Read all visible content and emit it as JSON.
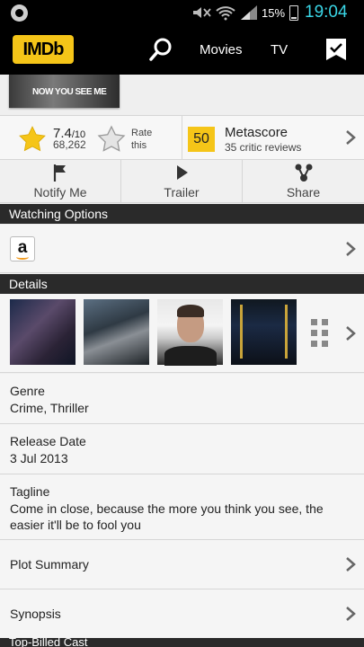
{
  "status_bar": {
    "battery": "15%",
    "time": "19:04"
  },
  "app_bar": {
    "logo": "IMDb",
    "nav_movies": "Movies",
    "nav_tv": "TV"
  },
  "poster": {
    "title_text": "NOW YOU SEE ME"
  },
  "rating": {
    "value": "7.4",
    "out_of": "/10",
    "count": "68,262",
    "rate_label": "Rate this"
  },
  "metascore": {
    "score": "50",
    "title": "Metascore",
    "reviews": "35 critic reviews"
  },
  "actions": {
    "notify": "Notify Me",
    "trailer": "Trailer",
    "share": "Share"
  },
  "sections": {
    "watching_options": "Watching Options",
    "details": "Details",
    "top_billed_cast": "Top-Billed Cast"
  },
  "watching_options": {
    "provider_icon": "amazon-icon",
    "provider_glyph": "a"
  },
  "details": {
    "genre_label": "Genre",
    "genre_value": "Crime, Thriller",
    "release_label": "Release Date",
    "release_value": "3 Jul 2013",
    "tagline_label": "Tagline",
    "tagline_value": "Come in close, because the more you think you see, the easier it'll be to fool you",
    "plot_summary": "Plot Summary",
    "synopsis": "Synopsis"
  },
  "colors": {
    "imdb_yellow": "#f5c518",
    "clock_cyan": "#3ad6e6",
    "header_dark": "#2a2a2a"
  }
}
